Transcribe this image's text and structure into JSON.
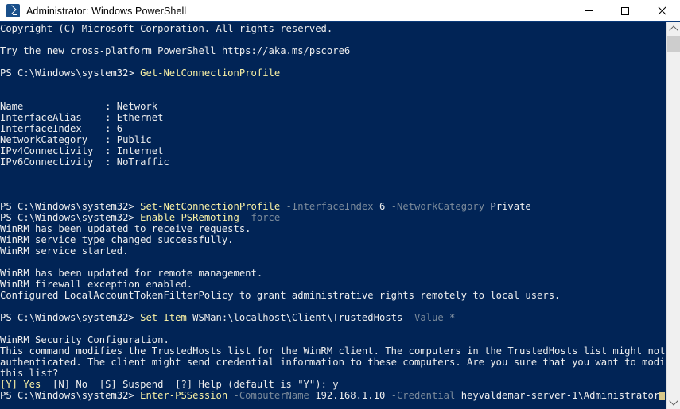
{
  "window": {
    "title": "Administrator: Windows PowerShell",
    "icon": "powershell-icon",
    "background_color": "#012456",
    "titlebar_color": "#ffffff",
    "controls": {
      "minimize_label": "Minimize",
      "maximize_label": "Maximize",
      "close_label": "Close"
    }
  },
  "colors": {
    "console_background": "#012456",
    "output_text": "#EEEEEE",
    "cmdlet_yellow": "#F9F1A5",
    "parameter_gray": "#7C8B9B",
    "cursor": "#D8C88A",
    "scrollbar_track": "#f0f0f0",
    "scrollbar_thumb": "#cdcdcd"
  },
  "scrollbar": {
    "up_arrow": "chevron-up-icon",
    "down_arrow": "chevron-down-icon",
    "thumb_position": "near-top"
  },
  "console": {
    "prompt": "PS C:\\Windows\\system32> ",
    "lines": [
      {
        "id": "l01",
        "type": "output",
        "text": "Copyright (C) Microsoft Corporation. All rights reserved."
      },
      {
        "id": "l02",
        "type": "blank",
        "text": ""
      },
      {
        "id": "l03",
        "type": "output",
        "text": "Try the new cross-platform PowerShell https://aka.ms/pscore6"
      },
      {
        "id": "l04",
        "type": "blank",
        "text": ""
      },
      {
        "id": "l05",
        "type": "command",
        "prompt": "PS C:\\Windows\\system32> ",
        "cmdlet": "Get-NetConnectionProfile",
        "rest": ""
      },
      {
        "id": "l06",
        "type": "blank",
        "text": ""
      },
      {
        "id": "l07",
        "type": "blank",
        "text": ""
      },
      {
        "id": "l08",
        "type": "property",
        "key": "Name",
        "value": "Network"
      },
      {
        "id": "l09",
        "type": "property",
        "key": "InterfaceAlias",
        "value": "Ethernet"
      },
      {
        "id": "l10",
        "type": "property",
        "key": "InterfaceIndex",
        "value": "6"
      },
      {
        "id": "l11",
        "type": "property",
        "key": "NetworkCategory",
        "value": "Public"
      },
      {
        "id": "l12",
        "type": "property",
        "key": "IPv4Connectivity",
        "value": "Internet"
      },
      {
        "id": "l13",
        "type": "property",
        "key": "IPv6Connectivity",
        "value": "NoTraffic"
      },
      {
        "id": "l14",
        "type": "blank",
        "text": ""
      },
      {
        "id": "l15",
        "type": "blank",
        "text": ""
      },
      {
        "id": "l16",
        "type": "blank",
        "text": ""
      },
      {
        "id": "l17",
        "type": "command2",
        "prompt": "PS C:\\Windows\\system32> ",
        "cmdlet": "Set-NetConnectionProfile",
        "p1": " -InterfaceIndex",
        "v1": " 6",
        "p2": " -NetworkCategory",
        "v2": " Private"
      },
      {
        "id": "l18",
        "type": "command3",
        "prompt": "PS C:\\Windows\\system32> ",
        "cmdlet": "Enable-PSRemoting",
        "p1": " -force"
      },
      {
        "id": "l19",
        "type": "output",
        "text": "WinRM has been updated to receive requests."
      },
      {
        "id": "l20",
        "type": "output",
        "text": "WinRM service type changed successfully."
      },
      {
        "id": "l21",
        "type": "output",
        "text": "WinRM service started."
      },
      {
        "id": "l22",
        "type": "blank",
        "text": ""
      },
      {
        "id": "l23",
        "type": "output",
        "text": "WinRM has been updated for remote management."
      },
      {
        "id": "l24",
        "type": "output",
        "text": "WinRM firewall exception enabled."
      },
      {
        "id": "l25",
        "type": "output",
        "text": "Configured LocalAccountTokenFilterPolicy to grant administrative rights remotely to local users."
      },
      {
        "id": "l26",
        "type": "blank",
        "text": ""
      },
      {
        "id": "l27",
        "type": "command4",
        "prompt": "PS C:\\Windows\\system32> ",
        "cmdlet": "Set-Item",
        "v1": " WSMan:\\localhost\\Client\\TrustedHosts",
        "p1": " -Value",
        "v2": " *"
      },
      {
        "id": "l28",
        "type": "blank",
        "text": ""
      },
      {
        "id": "l29",
        "type": "output",
        "text": "WinRM Security Configuration."
      },
      {
        "id": "l30",
        "type": "output",
        "text": "This command modifies the TrustedHosts list for the WinRM client. The computers in the TrustedHosts list might not be"
      },
      {
        "id": "l31",
        "type": "output",
        "text": "authenticated. The client might send credential information to these computers. Are you sure that you want to modify"
      },
      {
        "id": "l32",
        "type": "output",
        "text": "this list?"
      },
      {
        "id": "l33",
        "type": "choice",
        "yes": "[Y] Yes",
        "others": "  [N] No  [S] Suspend  [?] Help (default is \"Y\"): y"
      },
      {
        "id": "l34",
        "type": "command5",
        "prompt": "PS C:\\Windows\\system32> ",
        "cmdlet": "Enter-PSSession",
        "p1": " -ComputerName",
        "v1": " 192.168.1.10",
        "p2": " -Credential",
        "v2": " heyvaldemar-server-1\\Administrator",
        "cursor": true
      }
    ]
  }
}
